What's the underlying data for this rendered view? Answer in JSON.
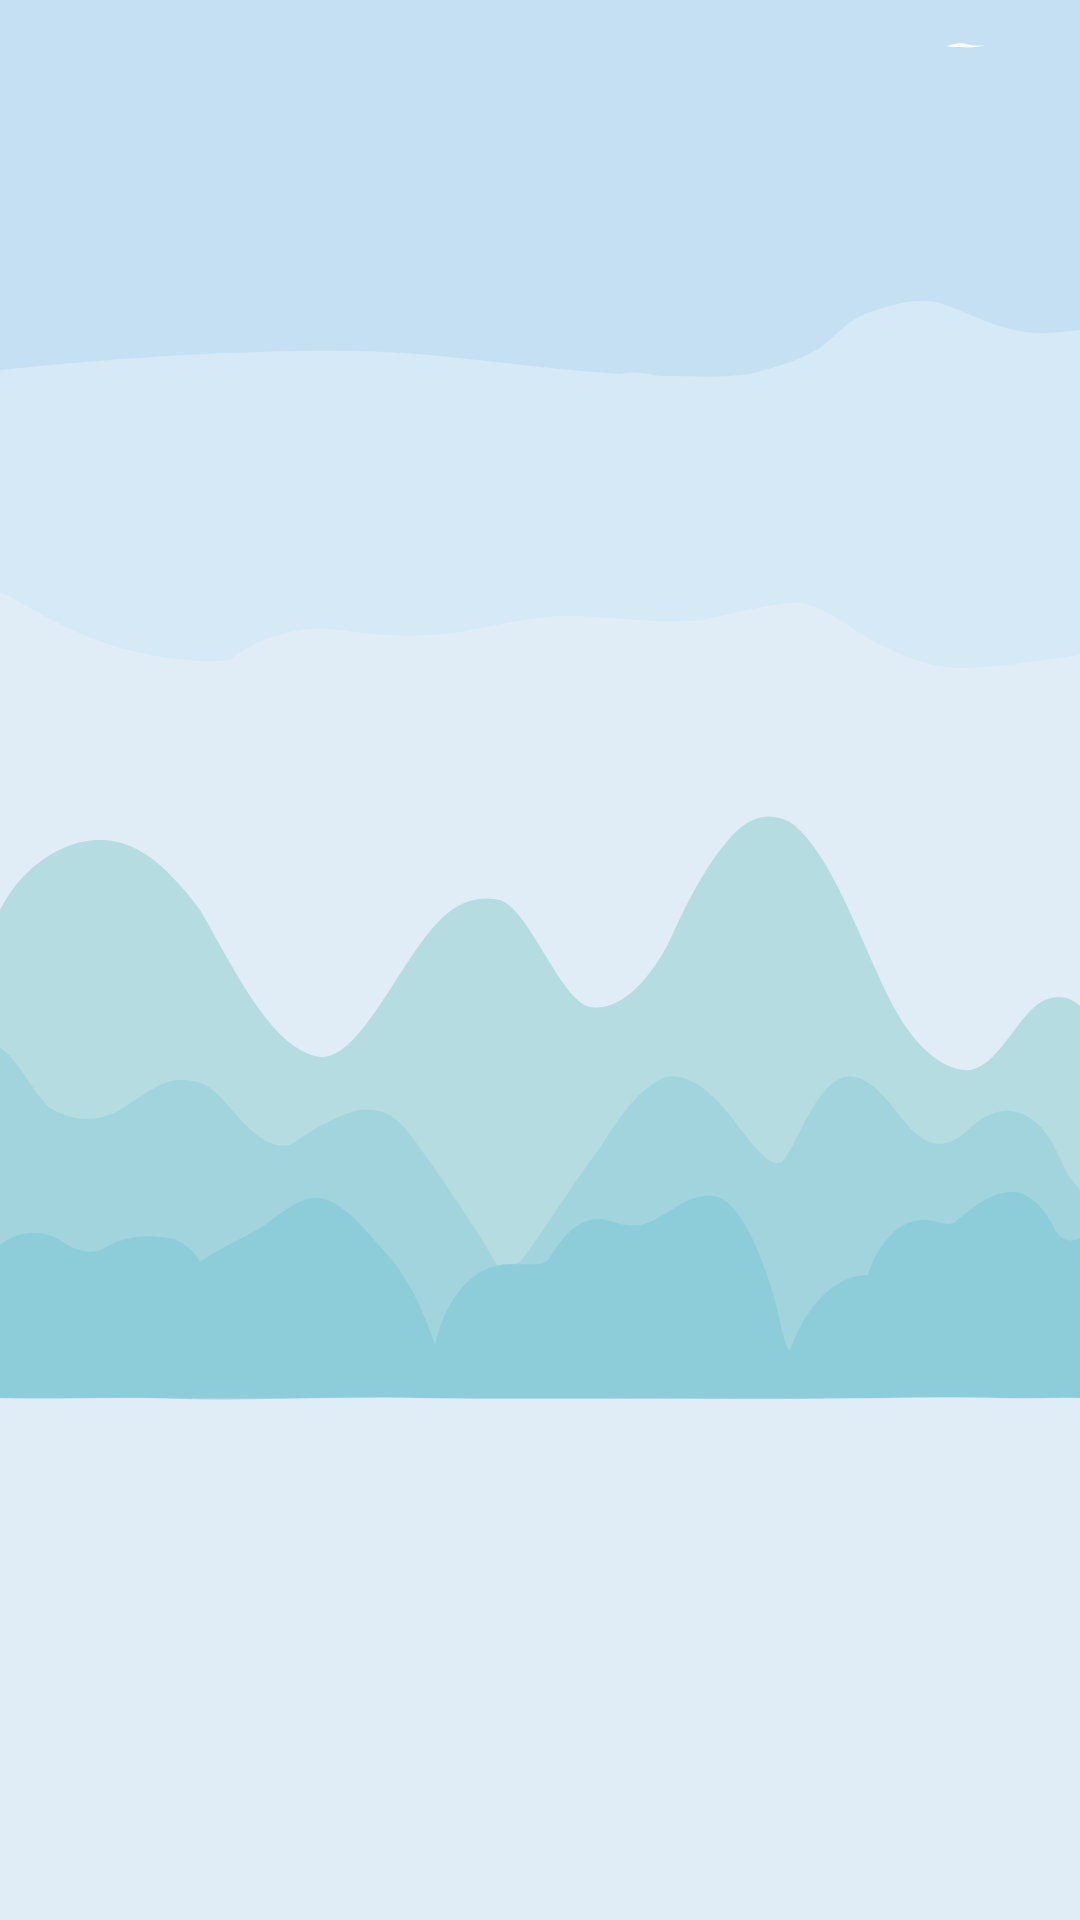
{
  "wallpaper": {
    "theme": "pastel mountain landscape",
    "colors": {
      "sky_top": "#c5e0f2",
      "sky_middle": "#d6e9f6",
      "sky_bottom": "#e1edf6",
      "mountains_far": "#b5dce0",
      "mountains_middle": "#a2d4dd",
      "mountains_near": "#8dcdd9",
      "ground": "#e1edf6",
      "bird": "#ffffff"
    }
  }
}
